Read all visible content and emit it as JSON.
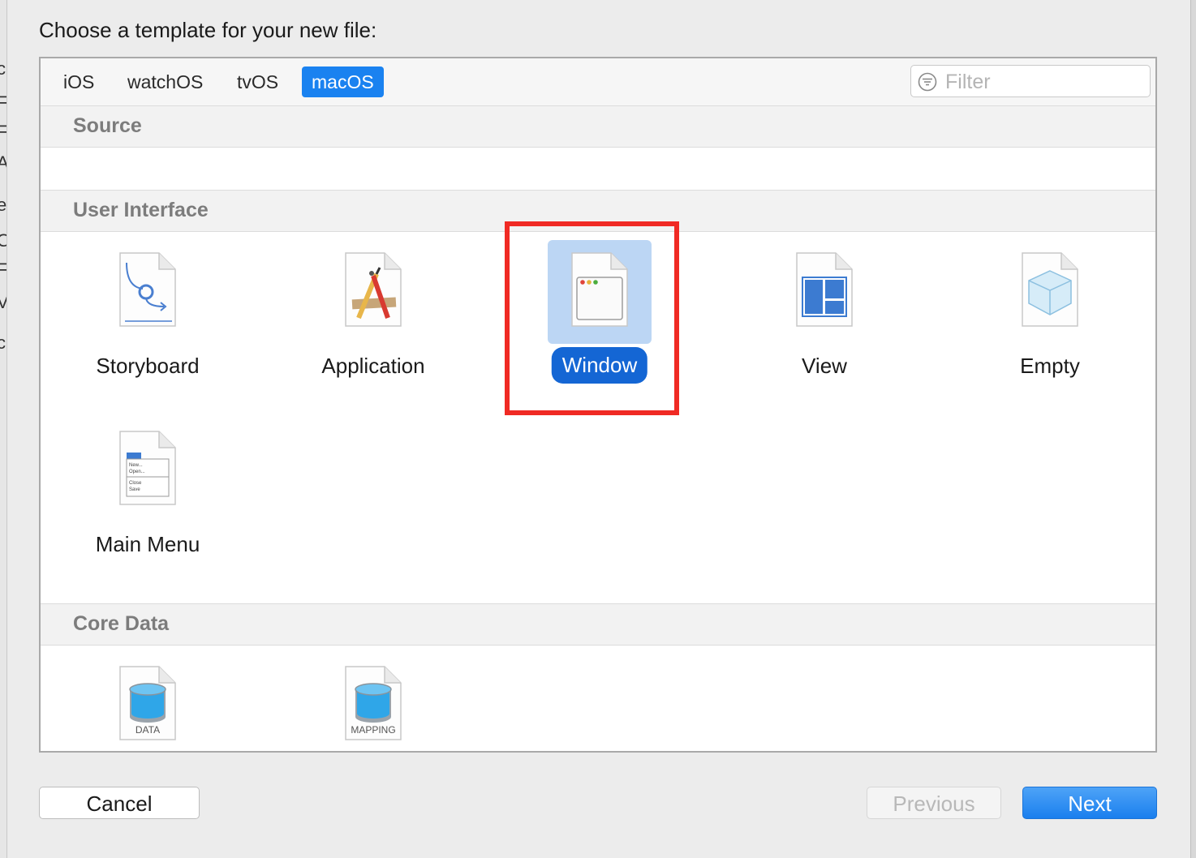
{
  "dialog": {
    "title": "Choose a template for your new file:"
  },
  "edge_glyphs": [
    "c",
    "F",
    "F",
    "A",
    "e",
    "O",
    "F",
    "V",
    "c"
  ],
  "platform_tabs": [
    {
      "label": "iOS",
      "active": false
    },
    {
      "label": "watchOS",
      "active": false
    },
    {
      "label": "tvOS",
      "active": false
    },
    {
      "label": "macOS",
      "active": true
    }
  ],
  "filter": {
    "placeholder": "Filter",
    "value": ""
  },
  "sections": {
    "source": {
      "title": "Source"
    },
    "user_interface": {
      "title": "User Interface",
      "items": [
        {
          "label": "Storyboard",
          "icon": "storyboard-icon",
          "selected": false
        },
        {
          "label": "Application",
          "icon": "application-icon",
          "selected": false
        },
        {
          "label": "Window",
          "icon": "window-icon",
          "selected": true
        },
        {
          "label": "View",
          "icon": "view-icon",
          "selected": false
        },
        {
          "label": "Empty",
          "icon": "empty-icon",
          "selected": false
        },
        {
          "label": "Main Menu",
          "icon": "main-menu-icon",
          "selected": false
        }
      ]
    },
    "core_data": {
      "title": "Core Data",
      "items": [
        {
          "icon_caption": "DATA",
          "icon": "data-model-icon"
        },
        {
          "icon_caption": "MAPPING",
          "icon": "mapping-model-icon"
        }
      ]
    }
  },
  "main_menu_icon_text": [
    "New...",
    "Open...",
    "Close",
    "Save"
  ],
  "buttons": {
    "cancel": "Cancel",
    "previous": "Previous",
    "next": "Next"
  },
  "colors": {
    "accent": "#1a82f0",
    "selection_bg": "#bcd6f4",
    "selection_label": "#1466d4",
    "annotation_box": "#f02a24"
  }
}
